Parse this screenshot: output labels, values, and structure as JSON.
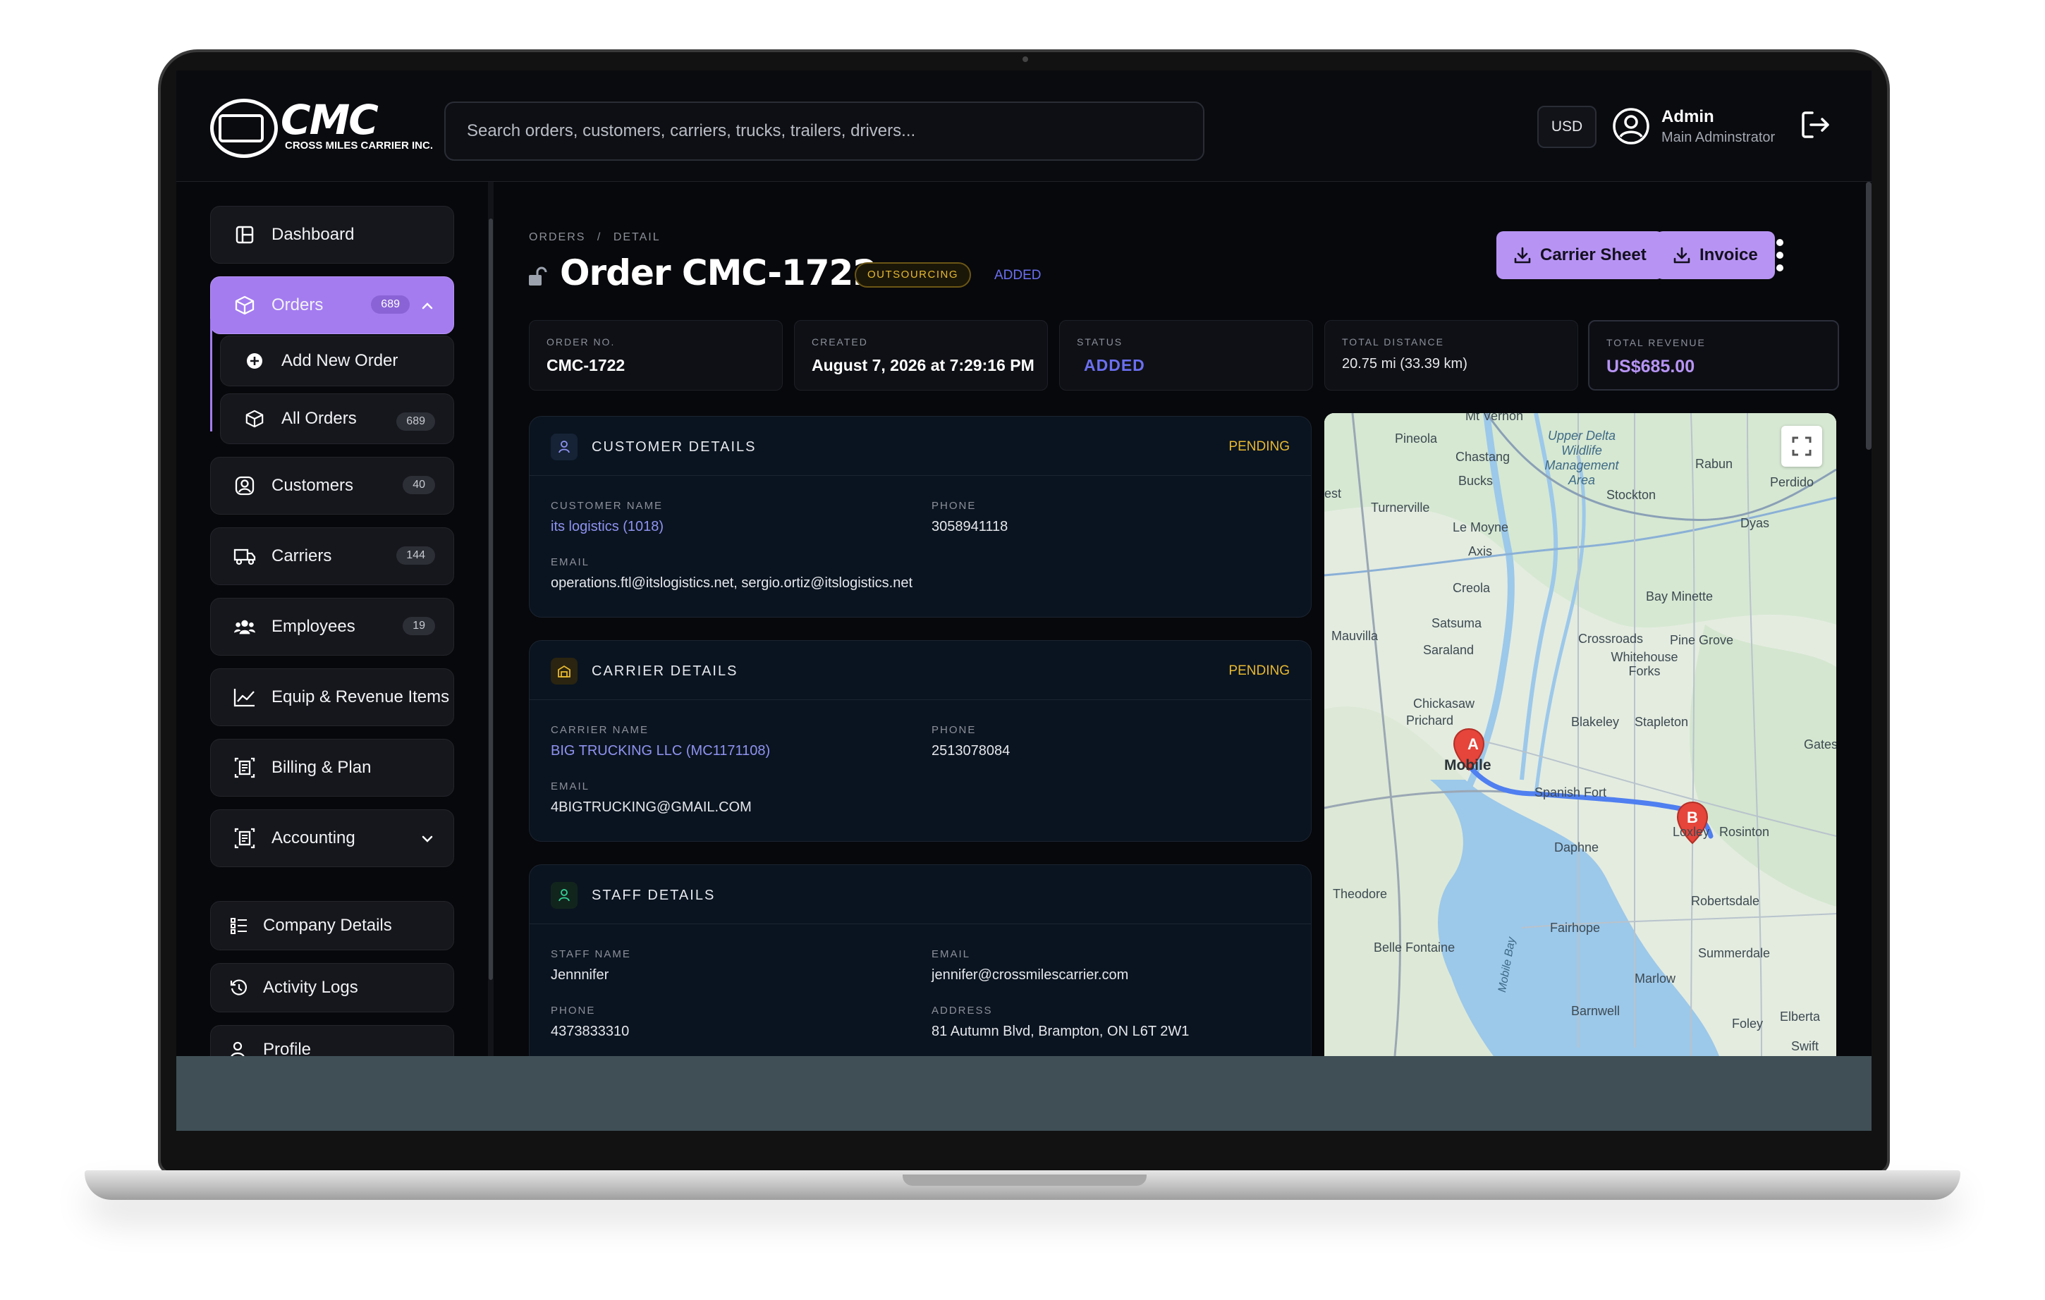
{
  "brand": {
    "logo_text": "CMC",
    "logo_subtitle": "CROSS MILES CARRIER INC."
  },
  "search": {
    "placeholder": "Search orders, customers, carriers, trucks, trailers, drivers..."
  },
  "header": {
    "currency": "USD",
    "user_name": "Admin",
    "user_role": "Main Adminstrator"
  },
  "sidebar": {
    "items": [
      {
        "label": "Dashboard",
        "icon": "dashboard-icon"
      },
      {
        "label": "Orders",
        "icon": "box-icon",
        "badge": "689",
        "active": true
      },
      {
        "label": "Add New Order",
        "icon": "plus-circle-icon"
      },
      {
        "label": "All Orders",
        "icon": "box-icon",
        "badge": "689"
      },
      {
        "label": "Customers",
        "icon": "user-circle-icon",
        "badge": "40"
      },
      {
        "label": "Carriers",
        "icon": "truck-icon",
        "badge": "144"
      },
      {
        "label": "Employees",
        "icon": "users-icon",
        "badge": "19"
      },
      {
        "label": "Equip & Revenue Items",
        "icon": "chart-line-icon"
      },
      {
        "label": "Billing & Plan",
        "icon": "receipt-icon"
      },
      {
        "label": "Accounting",
        "icon": "receipt-icon"
      },
      {
        "label": "Company Details",
        "icon": "list-icon"
      },
      {
        "label": "Activity Logs",
        "icon": "history-icon"
      },
      {
        "label": "Profile",
        "icon": "person-icon"
      }
    ]
  },
  "breadcrumb": {
    "section": "ORDERS",
    "separator": "/",
    "page": "DETAIL"
  },
  "order": {
    "title": "Order CMC-1722",
    "tag": "OUTSOURCING",
    "state": "ADDED"
  },
  "actions": {
    "carrier_sheet": "Carrier Sheet",
    "invoice": "Invoice"
  },
  "stats": [
    {
      "label": "ORDER NO.",
      "value": "CMC-1722"
    },
    {
      "label": "CREATED",
      "value": "August 7, 2026 at 7:29:16 PM"
    },
    {
      "label": "STATUS",
      "value": "ADDED"
    },
    {
      "label": "TOTAL DISTANCE",
      "value": "20.75 mi (33.39 km)"
    },
    {
      "label": "TOTAL REVENUE",
      "value": "US$685.00"
    }
  ],
  "customer": {
    "title": "CUSTOMER DETAILS",
    "status": "PENDING",
    "name_label": "CUSTOMER NAME",
    "name": "its logistics (1018)",
    "phone_label": "PHONE",
    "phone": "3058941118",
    "email_label": "EMAIL",
    "email": "operations.ftl@itslogistics.net, sergio.ortiz@itslogistics.net"
  },
  "carrier": {
    "title": "CARRIER DETAILS",
    "status": "PENDING",
    "name_label": "CARRIER NAME",
    "name": "BIG TRUCKING LLC (MC1171108)",
    "phone_label": "PHONE",
    "phone": "2513078084",
    "email_label": "EMAIL",
    "email": "4BIGTRUCKING@GMAIL.COM"
  },
  "staff": {
    "title": "STAFF DETAILS",
    "name_label": "STAFF NAME",
    "name": "Jennnifer",
    "email_label": "EMAIL",
    "email": "jennifer@crossmilescarrier.com",
    "phone_label": "PHONE",
    "phone": "4373833310",
    "address_label": "ADDRESS",
    "address": "81 Autumn Blvd, Brampton, ON L6T 2W1"
  },
  "map": {
    "marker_a": "A",
    "marker_b": "B",
    "labels": [
      "Mt Vernon",
      "Pineola",
      "Chastang",
      "Upper Delta Wildlife Management Area",
      "Rabun",
      "Perdido",
      "Bucks",
      "Stockton",
      "est",
      "Turnerville",
      "Le Moyne",
      "Dyas",
      "Axis",
      "Creola",
      "Bay Minette",
      "Satsuma",
      "Mauvilla",
      "Saraland",
      "Crossroads",
      "Pine Grove",
      "Whitehouse Forks",
      "Chickasaw",
      "Prichard",
      "Blakeley",
      "Stapleton",
      "Gatesw",
      "Mobile",
      "Spanish Fort",
      "Loxley",
      "Rosinton",
      "Daphne",
      "Theodore",
      "Robertsdale",
      "Fairhope",
      "Belle Fontaine",
      "Summerdale",
      "Mobile Bay",
      "Marlow",
      "Barnwell",
      "Foley",
      "Elberta",
      "Swift"
    ],
    "route_color": "#4f7ff0",
    "marker_color": "#e5453b"
  },
  "colors": {
    "accent": "#b794f4",
    "pending": "#e8b930",
    "added": "#6b6ff0"
  }
}
